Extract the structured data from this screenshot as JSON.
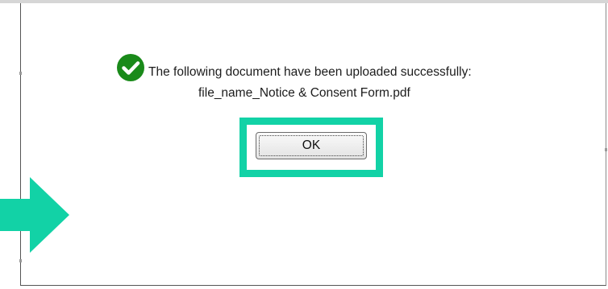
{
  "dialog": {
    "success_message": "The following document have been uploaded successfully:",
    "filename": "file_name_Notice & Consent Form.pdf",
    "ok_label": "OK"
  },
  "icons": {
    "status": "check-circle-icon",
    "pointer": "arrow-right-icon"
  },
  "colors": {
    "success_green": "#1a8a1a",
    "highlight_teal": "#12d2a6"
  }
}
